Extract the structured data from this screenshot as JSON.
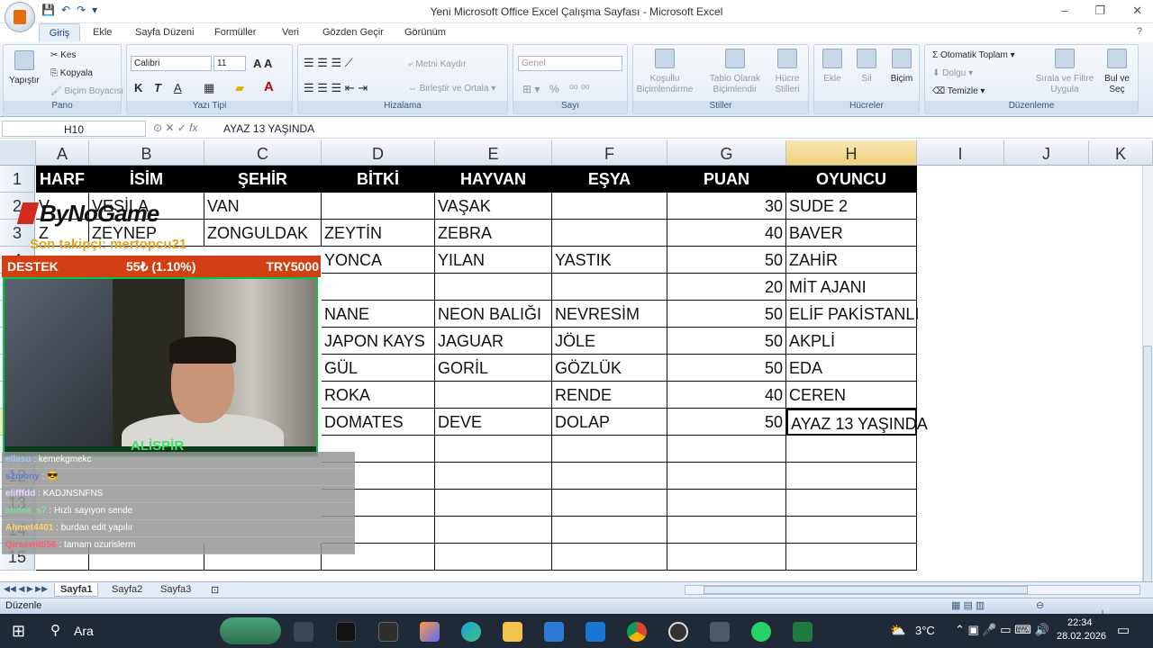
{
  "window": {
    "title": "Yeni Microsoft Office Excel Çalışma Sayfası - Microsoft Excel",
    "controls": [
      "–",
      "❐",
      "✕"
    ]
  },
  "ribbon_tabs": [
    "Giriş",
    "Ekle",
    "Sayfa Düzeni",
    "Formüller",
    "Veri",
    "Gözden Geçir",
    "Görünüm"
  ],
  "ribbon": {
    "pano": {
      "label": "Pano",
      "paste": "Yapıştır",
      "cut": "Kes",
      "copy": "Kopyala",
      "format_painter": "Biçim Boyacısı"
    },
    "yazi_tipi": {
      "label": "Yazı Tipi",
      "font": "Calibri",
      "size": "11",
      "bold": "K",
      "italic": "T",
      "underline": "A"
    },
    "hizalama": {
      "label": "Hizalama",
      "wrap": "Metni Kaydır",
      "merge": "Birleştir ve Ortala"
    },
    "sayi": {
      "label": "Sayı",
      "format": "Genel",
      "percent": "%"
    },
    "stiller": {
      "label": "Stiller",
      "cond": "Koşullu\nBiçimlendirme",
      "table": "Tablo Olarak\nBiçimlendir",
      "cell": "Hücre\nStilleri"
    },
    "hucreler": {
      "label": "Hücreler",
      "insert": "Ekle",
      "delete": "Sil",
      "format": "Biçim"
    },
    "duzenleme": {
      "label": "Düzenleme",
      "autosum": "Otomatik Toplam",
      "fill": "Dolgu",
      "clear": "Temizle",
      "sort": "Sırala ve Filtre\nUygula",
      "find": "Bul ve\nSeç"
    }
  },
  "formula_bar": {
    "name_box": "H10",
    "fx": "fx",
    "content": "AYAZ 13 YAŞINDA"
  },
  "columns": [
    "A",
    "B",
    "C",
    "D",
    "E",
    "F",
    "G",
    "H",
    "I",
    "J",
    "K"
  ],
  "rows": [
    "1",
    "2",
    "3",
    "4",
    "5",
    "6",
    "7",
    "8",
    "9",
    "10",
    "11",
    "12",
    "13",
    "14",
    "15"
  ],
  "sheet": {
    "header": [
      "HARF",
      "İSİM",
      "ŞEHİR",
      "BİTKİ",
      "HAYVAN",
      "EŞYA",
      "PUAN",
      "OYUNCU"
    ],
    "visible_cells": [
      {
        "row": 2,
        "A": "V",
        "B": "VESİLA",
        "C": "VAN",
        "D": "",
        "E": "VAŞAK",
        "F": "",
        "G": "30",
        "H": "SUDE 2"
      },
      {
        "row": 3,
        "A": "Z",
        "B": "ZEYNEP",
        "C": "ZONGULDAK",
        "D": "ZEYTİN",
        "E": "ZEBRA",
        "F": "",
        "G": "40",
        "H": "BAVER"
      },
      {
        "row": 4,
        "D": "YONCA",
        "E": "YILAN",
        "F": "YASTIK",
        "G": "50",
        "H": "ZAHİR"
      },
      {
        "row": 5,
        "D": "",
        "E": "",
        "F": "",
        "G": "20",
        "H": "MİT AJANI"
      },
      {
        "row": 6,
        "D": "NANE",
        "E": "NEON BALIĞI",
        "F": "NEVRESİM",
        "G": "50",
        "H": "ELİF PAKİSTANLI"
      },
      {
        "row": 7,
        "D": "JAPON KAYS",
        "E": "JAGUAR",
        "F": "JÖLE",
        "G": "50",
        "H": "AKPLİ"
      },
      {
        "row": 8,
        "D": "GÜL",
        "E": "GORİL",
        "F": "GÖZLÜK",
        "G": "50",
        "H": "EDA"
      },
      {
        "row": 9,
        "D": "ROKA",
        "E": "",
        "F": "RENDE",
        "G": "40",
        "H": "CEREN"
      },
      {
        "row": 10,
        "D": "DOMATES",
        "E": "DEVE",
        "F": "DOLAP",
        "G": "50",
        "H": "AYAZ 13 YAŞINDA"
      }
    ]
  },
  "sheet_tabs": [
    "Sayfa1",
    "Sayfa2",
    "Sayfa3"
  ],
  "status": {
    "mode": "Düzenle"
  },
  "overlay": {
    "logo": "ByNoGame",
    "last_follower": "Son takipçi: mertopcu21",
    "donation_label": "DESTEK",
    "donation_progress": "55₺ (1.10%)",
    "donation_goal": "TRY5000",
    "streamer_name": "ALİSPİR",
    "chat": [
      {
        "user": "ellasu",
        "msg": "kemekgmekc"
      },
      {
        "user": "s2mony",
        "msg": ""
      },
      {
        "user": "elifffdd",
        "msg": "KADJNSNFNS"
      },
      {
        "user": "stidee_s7",
        "msg": "Hızlı sayıyon sende"
      },
      {
        "user": "Ahmet4401",
        "msg": "burdan edit yapılır"
      },
      {
        "user": "Qirsewitti56",
        "msg": "tamam ozurislerm"
      }
    ]
  },
  "taskbar": {
    "search": "Ara",
    "weather": "3°C",
    "time": "22:34",
    "date": "28.02.2026"
  }
}
